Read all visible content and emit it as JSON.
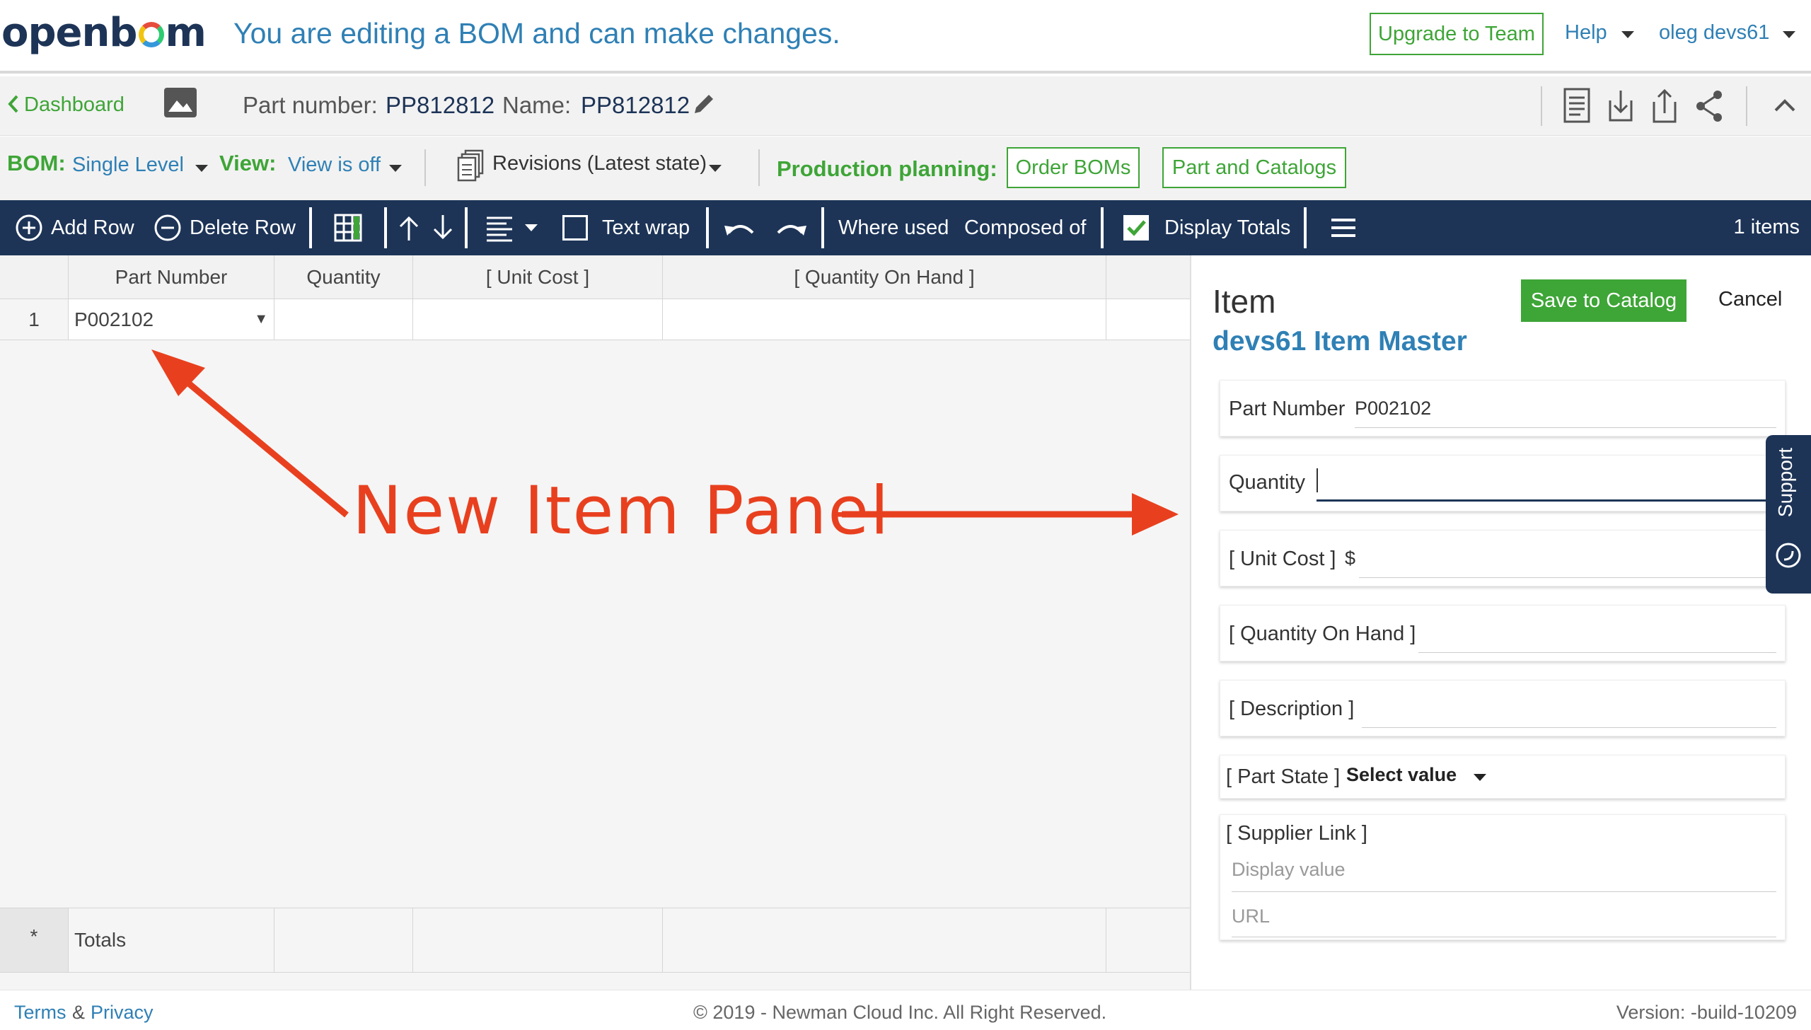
{
  "header": {
    "logo": "openbom",
    "edit_message": "You are editing a BOM and can make changes.",
    "upgrade_label": "Upgrade to Team",
    "help_label": "Help",
    "user_label": "oleg devs61"
  },
  "part_bar": {
    "back_label": "Dashboard",
    "part_number_label": "Part number:",
    "part_number_value": "PP812812",
    "name_label": "Name:",
    "name_value": "PP812812"
  },
  "bom_bar": {
    "bom_label": "BOM:",
    "bom_value": "Single Level",
    "view_label": "View:",
    "view_value": "View is off",
    "revisions_label": "Revisions (Latest state)",
    "production_label": "Production planning:",
    "order_boms_label": "Order BOMs",
    "part_catalogs_label": "Part and Catalogs"
  },
  "toolbar": {
    "add_row": "Add Row",
    "delete_row": "Delete Row",
    "text_wrap": "Text wrap",
    "where_used": "Where used",
    "composed_of": "Composed of",
    "display_totals": "Display Totals",
    "items_count": "1 items"
  },
  "grid": {
    "columns": [
      "Part Number",
      "Quantity",
      "[ Unit Cost ]",
      "[ Quantity On Hand ]"
    ],
    "rows": [
      {
        "index": "1",
        "part_number": "P002102",
        "dropdown_glyph": "▼"
      }
    ],
    "totals_marker": "*",
    "totals_label": "Totals"
  },
  "annotation": {
    "text": "New Item Panel",
    "color": "#e8401f"
  },
  "panel": {
    "title": "Item",
    "subtitle": "devs61 Item Master",
    "save_label": "Save to Catalog",
    "cancel_label": "Cancel",
    "fields": {
      "part_number_label": "Part Number",
      "part_number_value": "P002102",
      "quantity_label": "Quantity",
      "unit_cost_label": "[ Unit Cost ]",
      "unit_cost_prefix": "$",
      "qoh_label": "[ Quantity On Hand ]",
      "description_label": "[ Description ]",
      "part_state_label": "[ Part State ]",
      "part_state_value": "Select value",
      "supplier_label": "[ Supplier Link ]",
      "supplier_display_placeholder": "Display value",
      "supplier_url_placeholder": "URL"
    },
    "support_label": "Support"
  },
  "footer": {
    "terms": "Terms",
    "amp": "&",
    "privacy": "Privacy",
    "copyright": "© 2019 - Newman Cloud Inc. All Right Reserved.",
    "version": "Version: -build-10209"
  },
  "colors": {
    "brand_navy": "#1d3457",
    "accent_green": "#3ea537",
    "link_blue": "#2f80b5"
  }
}
